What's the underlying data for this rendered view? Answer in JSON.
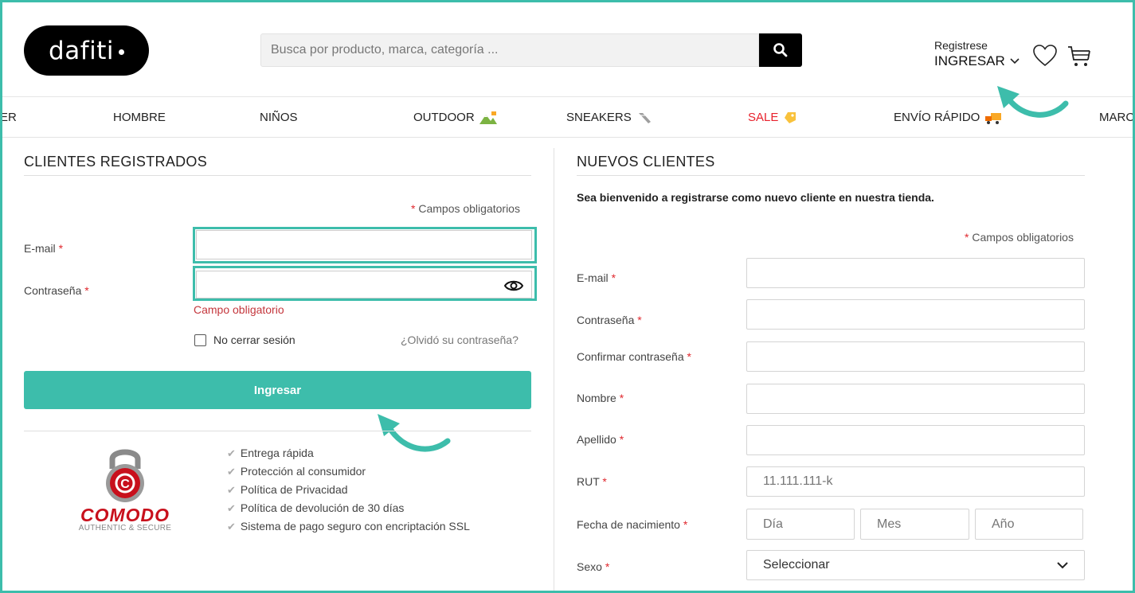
{
  "header": {
    "logo_text": "dafiti",
    "search_placeholder": "Busca por producto, marca, categoría ...",
    "account_register": "Registrese",
    "account_login": "INGRESAR"
  },
  "nav": {
    "items": [
      "ER",
      "HOMBRE",
      "NIÑOS",
      "OUTDOOR",
      "SNEAKERS",
      "SALE",
      "ENVÍO RÁPIDO",
      "MARC"
    ]
  },
  "login": {
    "title": "CLIENTES REGISTRADOS",
    "required_note": "Campos obligatorios",
    "email_label": "E-mail",
    "password_label": "Contraseña",
    "email_value": "",
    "password_value": "",
    "error_text": "Campo obligatorio",
    "remember_label": "No cerrar sesión",
    "remember_checked": false,
    "forgot_link": "¿Olvidó su contraseña?",
    "submit_label": "Ingresar"
  },
  "trust": {
    "brand": "COMODO",
    "tagline": "AUTHENTIC & SECURE",
    "perks": [
      "Entrega rápida",
      "Protección al consumidor",
      "Política de Privacidad",
      "Política de devolución de 30 días",
      "Sistema de pago seguro con encriptación SSL"
    ]
  },
  "register": {
    "title": "NUEVOS CLIENTES",
    "welcome": "Sea bienvenido a registrarse como nuevo cliente en nuestra tienda.",
    "required_note": "Campos obligatorios",
    "email_label": "E-mail",
    "password_label": "Contraseña",
    "confirm_label": "Confirmar contraseña",
    "name_label": "Nombre",
    "surname_label": "Apellido",
    "rut_label": "RUT",
    "rut_placeholder": "11.111.111-k",
    "birth_label": "Fecha de nacimiento",
    "day_placeholder": "Día",
    "month_placeholder": "Mes",
    "year_placeholder": "Año",
    "sex_label": "Sexo",
    "sex_value": "Seleccionar"
  },
  "colors": {
    "accent": "#3dbdab",
    "error": "#c4363c",
    "sale": "#e8212c"
  }
}
